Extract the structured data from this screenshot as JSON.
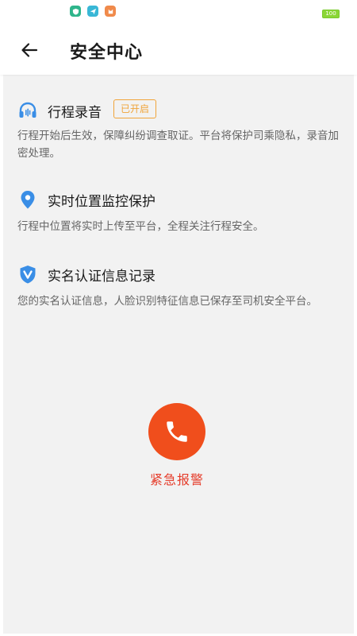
{
  "status_bar": {
    "battery_level": "100",
    "app_icons": [
      "shield-app-icon",
      "send-app-icon",
      "cat-app-icon"
    ]
  },
  "header": {
    "title": "安全中心",
    "back_icon": "arrow-left-icon"
  },
  "sections": [
    {
      "icon": "headset-icon",
      "title": "行程录音",
      "badge": "已开启",
      "description": "行程开始后生效，保障纠纷调查取证。平台将保护司乘隐私，录音加密处理。"
    },
    {
      "icon": "location-pin-icon",
      "title": "实时位置监控保护",
      "description": "行程中位置将实时上传至平台，全程关注行程安全。"
    },
    {
      "icon": "verified-shield-icon",
      "title": "实名认证信息记录",
      "description": "您的实名认证信息，人脸识别特征信息已保存至司机安全平台。"
    }
  ],
  "emergency": {
    "label": "紧急报警",
    "icon": "phone-icon"
  },
  "colors": {
    "accent_blue": "#3a8ee6",
    "badge_orange": "#f0a43a",
    "sos_orange": "#f04e1c",
    "sos_label_red": "#e53c2a",
    "background_gray": "#f2f2f2"
  }
}
